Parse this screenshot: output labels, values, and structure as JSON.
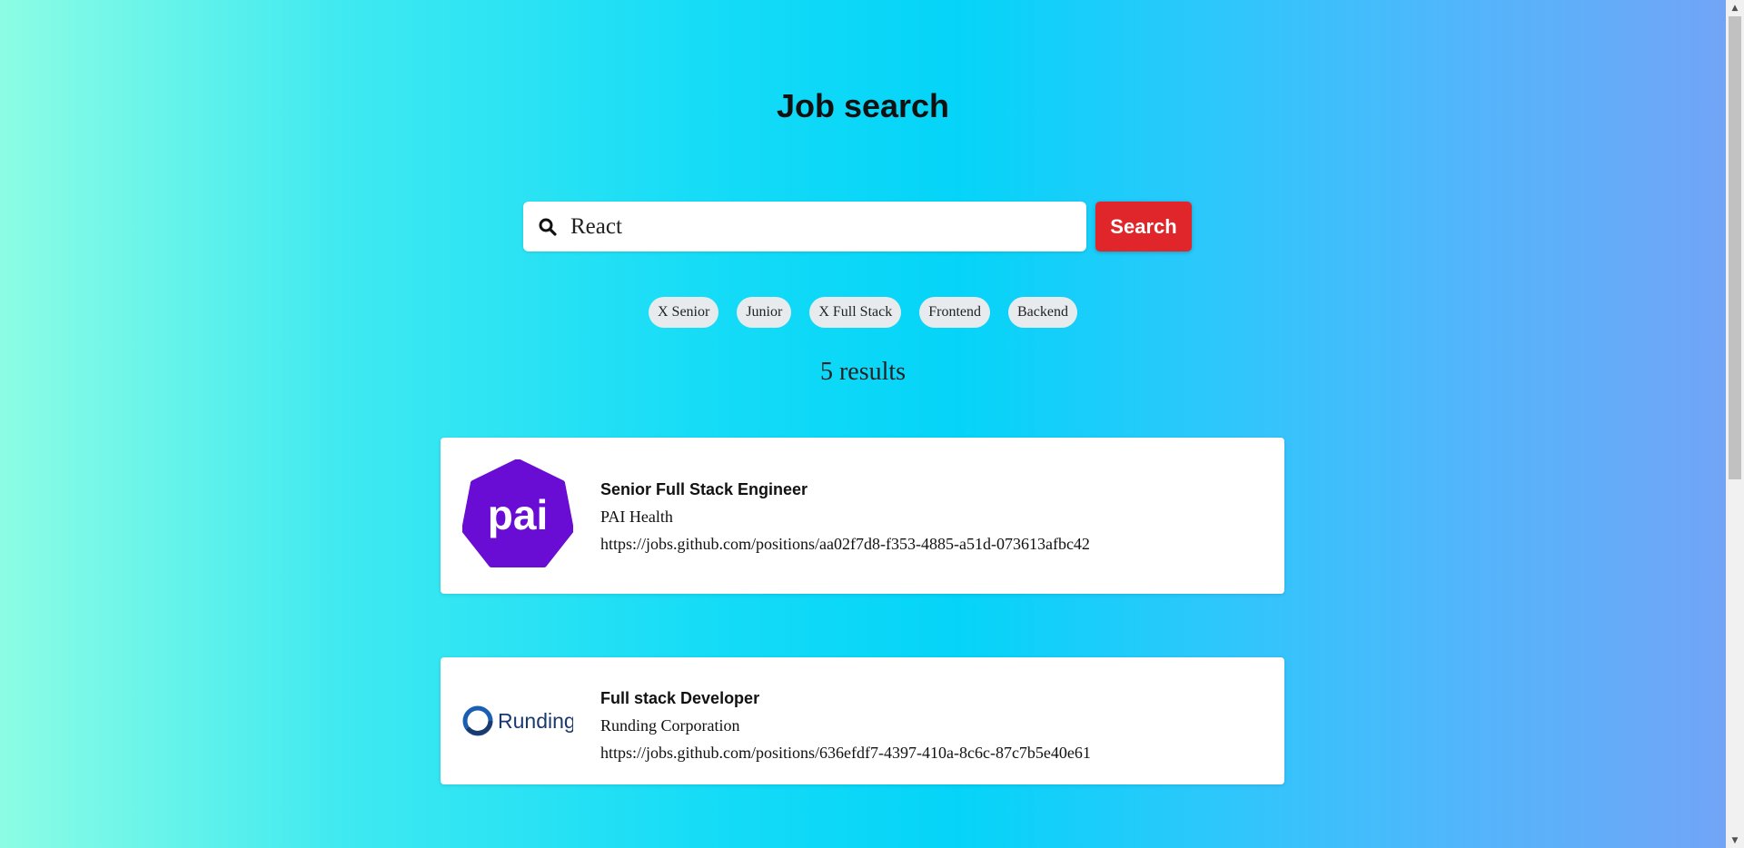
{
  "header": {
    "title": "Job search"
  },
  "search": {
    "value": "React",
    "button_label": "Search",
    "icon": "search-icon"
  },
  "filters": [
    {
      "label": "X Senior"
    },
    {
      "label": "Junior"
    },
    {
      "label": "X Full Stack"
    },
    {
      "label": "Frontend"
    },
    {
      "label": "Backend"
    }
  ],
  "results": {
    "count_label": "5 results",
    "items": [
      {
        "title": "Senior Full Stack Engineer",
        "company": "PAI Health",
        "url": "https://jobs.github.com/positions/aa02f7d8-f353-4885-a51d-073613afbc42",
        "logo_text": "pai"
      },
      {
        "title": "Full stack Developer",
        "company": "Runding Corporation",
        "url": "https://jobs.github.com/positions/636efdf7-4397-410a-8c6c-87c7b5e40e61",
        "logo_text": "Runding"
      }
    ]
  },
  "colors": {
    "search_button": "#e0262a",
    "pai_logo": "#6a0dd4",
    "runding_logo": "#1a3a6e"
  }
}
